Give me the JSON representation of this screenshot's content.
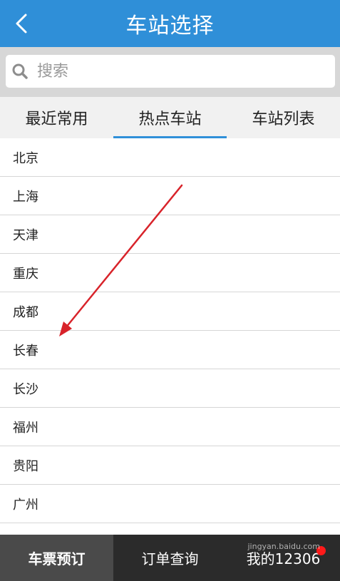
{
  "header": {
    "title": "车站选择",
    "back_icon": "chevron-left-icon"
  },
  "search": {
    "placeholder": "搜索",
    "value": ""
  },
  "tabs": [
    {
      "label": "最近常用",
      "active": false
    },
    {
      "label": "热点车站",
      "active": true
    },
    {
      "label": "车站列表",
      "active": false
    }
  ],
  "stations": [
    "北京",
    "上海",
    "天津",
    "重庆",
    "成都",
    "长春",
    "长沙",
    "福州",
    "贵阳",
    "广州"
  ],
  "bottom_nav": [
    {
      "label": "车票预订",
      "active": true
    },
    {
      "label": "订单查询",
      "active": false
    },
    {
      "label": "我的12306",
      "active": false,
      "badge": true
    }
  ],
  "colors": {
    "accent": "#2f8fd8",
    "arrow": "#d8232a",
    "badge": "#ff1a1a"
  },
  "watermark": "jingyan.baidu.com"
}
